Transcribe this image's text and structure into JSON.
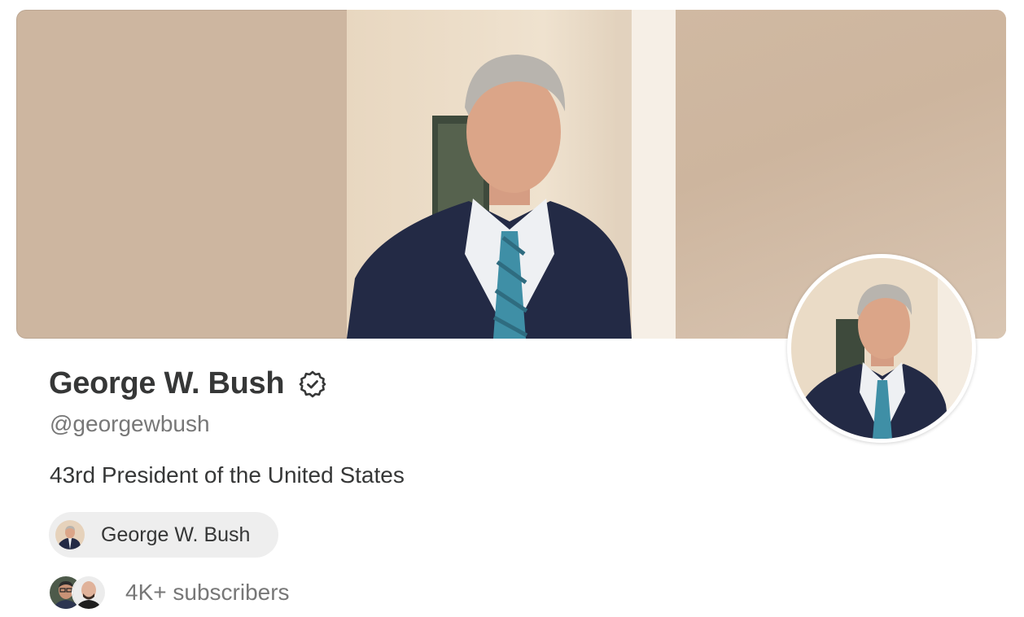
{
  "profile": {
    "name": "George W. Bush",
    "handle": "@georgewbush",
    "bio": "43rd President of the United States",
    "verified_icon": "verified-badge-icon"
  },
  "publication_chip": {
    "label": "George W. Bush"
  },
  "subscribers": {
    "text": "4K+ subscribers"
  },
  "colors": {
    "banner_bg": "#cdb6a0",
    "text_primary": "#363737",
    "text_secondary": "#777777",
    "chip_bg": "#eeeeee"
  }
}
